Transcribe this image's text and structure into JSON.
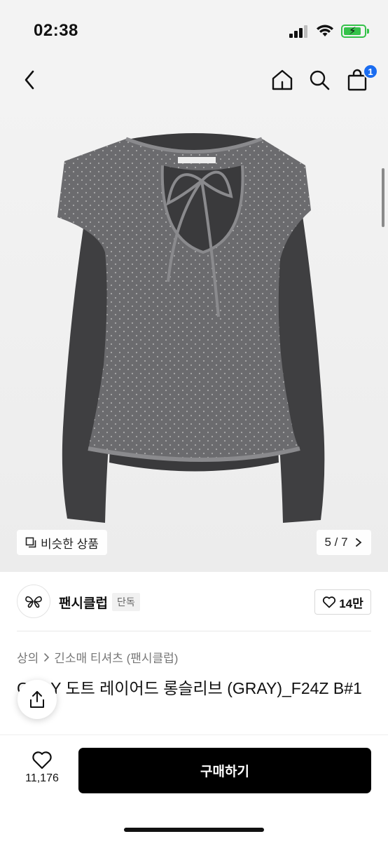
{
  "status_bar": {
    "time": "02:38"
  },
  "nav": {
    "back_icon": "chevron-left-icon",
    "home_icon": "home-icon",
    "search_icon": "search-icon",
    "cart_icon": "shopping-bag-icon",
    "cart_badge": "1",
    "badge_color": "#1a6cf0"
  },
  "image": {
    "similar_label": "비슷한 상품",
    "counter": "5 / 7"
  },
  "brand": {
    "name": "팬시클럽",
    "badge": "단독",
    "likes": "14만"
  },
  "breadcrumb": {
    "items": [
      "상의",
      "긴소매 티셔츠 (팬시클럽)"
    ]
  },
  "product": {
    "title": "GRAY 도트 레이어드 롱슬리브 (GRAY)_F24Z B#1"
  },
  "bottom_bar": {
    "wish_count": "11,176",
    "buy_label": "구매하기"
  },
  "colors": {
    "accent": "#1a6cf0",
    "buy_button": "#000000",
    "battery": "#35c24a"
  }
}
